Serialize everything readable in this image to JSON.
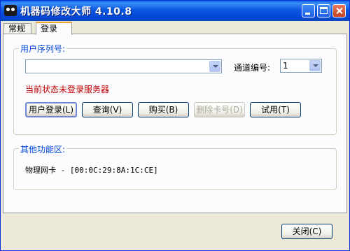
{
  "window": {
    "title": "机器码修改大师 4.10.8"
  },
  "tabs": [
    {
      "label": "常规"
    },
    {
      "label": "登录"
    }
  ],
  "login": {
    "serial_label": "用户序列号:",
    "serial_value": "",
    "channel_label": "通道编号:",
    "channel_value": "1",
    "status_text": "当前状态未登录服务器",
    "status_color": "#C00000",
    "buttons": {
      "login": "用户登录(L)",
      "query": "查询(V)",
      "buy": "购买(B)",
      "delete": "删除卡号(D)",
      "trial": "试用(T)"
    }
  },
  "other": {
    "label": "其他功能区:",
    "mac_text": "物理网卡 - [00:0C:29:8A:1C:CE]"
  },
  "footer": {
    "close_label": "关闭(C)"
  }
}
